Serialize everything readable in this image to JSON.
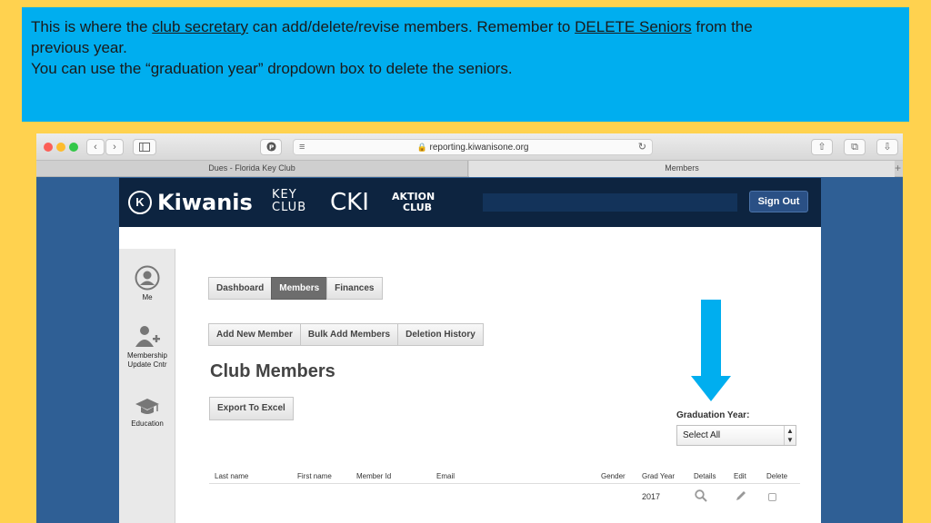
{
  "banner": {
    "line1_part1": "This is where the ",
    "line1_link1": "club secretary",
    "line1_part2": " can add/delete/revise members. Remember to ",
    "line1_link2": "DELETE Seniors",
    "line1_part3": " from the",
    "line2": "previous year.",
    "line3": "You can use the “graduation year” dropdown box to delete the seniors."
  },
  "browser": {
    "url": "reporting.kiwanisone.org",
    "tabs": [
      "Dues - Florida Key Club",
      "Members"
    ]
  },
  "site": {
    "brand": {
      "kiwanis": "Kiwanis",
      "kiwanis_mark": "K",
      "key_top": "KEY",
      "key_bottom": "CLUB",
      "cki": "CKI",
      "aktion_top": "AKTION",
      "aktion_bottom": "CLUB"
    },
    "sign_out": "Sign Out"
  },
  "sidebar": {
    "items": [
      {
        "label": "Me",
        "icon": "user-icon"
      },
      {
        "label": "Membership Update Cntr",
        "icon": "add-user-icon"
      },
      {
        "label": "Education",
        "icon": "graduation-cap-icon"
      }
    ]
  },
  "nav_tabs": [
    "Dashboard",
    "Members",
    "Finances"
  ],
  "actions": [
    "Add New Member",
    "Bulk Add Members",
    "Deletion History"
  ],
  "page_title": "Club Members",
  "export_button": "Export To Excel",
  "graduation_filter": {
    "label": "Graduation Year:",
    "selected": "Select All"
  },
  "table": {
    "headers": [
      "Last name",
      "First name",
      "Member Id",
      "Email",
      "Gender",
      "Grad Year",
      "Details",
      "Edit",
      "Delete"
    ],
    "rows": [
      {
        "grad_year": "2017"
      }
    ]
  },
  "colors": {
    "banner_bg": "#00aeef",
    "slide_bg": "#ffd24f",
    "arrow": "#00aeef",
    "header_bg": "#0d2440"
  }
}
